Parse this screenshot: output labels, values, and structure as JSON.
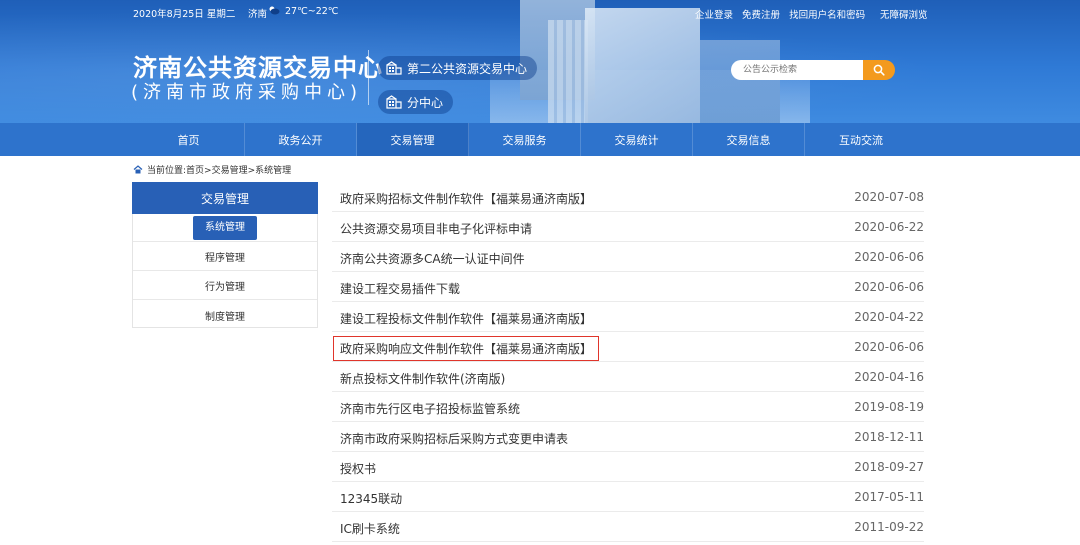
{
  "header": {
    "date": "2020年8月25日 星期二",
    "city": "济南",
    "temperature": "27℃~22℃",
    "links": [
      "企业登录",
      "免费注册",
      "找回用户名和密码"
    ],
    "barrier_free": "无障碍浏览",
    "logo_main": "济南公共资源交易中心",
    "logo_sub": "(济南市政府采购中心)",
    "center_buttons": [
      "第二公共资源交易中心",
      "分中心"
    ],
    "search_placeholder": "公告公示检索"
  },
  "nav": {
    "items": [
      "首页",
      "政务公开",
      "交易管理",
      "交易服务",
      "交易统计",
      "交易信息",
      "互动交流"
    ],
    "active_index": 2
  },
  "breadcrumb": {
    "label": "当前位置:",
    "path": "首页>交易管理>系统管理"
  },
  "sidebar": {
    "heading": "交易管理",
    "items": [
      "系统管理",
      "程序管理",
      "行为管理",
      "制度管理"
    ],
    "active_index": 0
  },
  "list": {
    "highlight_index": 5,
    "items": [
      {
        "title": "政府采购招标文件制作软件【福莱易通济南版】",
        "date": "2020-07-08"
      },
      {
        "title": "公共资源交易项目非电子化评标申请",
        "date": "2020-06-22"
      },
      {
        "title": "济南公共资源多CA统一认证中间件",
        "date": "2020-06-06"
      },
      {
        "title": "建设工程交易插件下载",
        "date": "2020-06-06"
      },
      {
        "title": "建设工程投标文件制作软件【福莱易通济南版】",
        "date": "2020-04-22"
      },
      {
        "title": "政府采购响应文件制作软件【福莱易通济南版】",
        "date": "2020-06-06"
      },
      {
        "title": "新点投标文件制作软件(济南版)",
        "date": "2020-04-16"
      },
      {
        "title": "济南市先行区电子招投标监管系统",
        "date": "2019-08-19"
      },
      {
        "title": "济南市政府采购招标后采购方式变更申请表",
        "date": "2018-12-11"
      },
      {
        "title": "授权书",
        "date": "2018-09-27"
      },
      {
        "title": "12345联动",
        "date": "2017-05-11"
      },
      {
        "title": "IC刷卡系统",
        "date": "2011-09-22"
      }
    ]
  },
  "colors": {
    "header_blue": "#2f7ad6",
    "nav_blue": "#2e73cc",
    "sidebar_blue": "#2860b6",
    "search_orange": "#f39a1e",
    "highlight_red": "#e0352b"
  }
}
